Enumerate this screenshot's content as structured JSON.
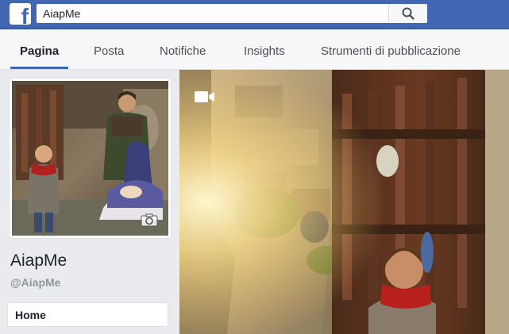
{
  "search": {
    "value": "AiapMe"
  },
  "tabs": [
    {
      "label": "Pagina",
      "active": true
    },
    {
      "label": "Posta"
    },
    {
      "label": "Notifiche"
    },
    {
      "label": "Insights"
    },
    {
      "label": "Strumenti di pubblicazione"
    }
  ],
  "page": {
    "name": "AiapMe",
    "handle": "@AiapMe"
  },
  "sidebar": {
    "items": [
      {
        "label": "Home"
      }
    ]
  },
  "icons": {
    "logo": "facebook-logo-icon",
    "search": "search-icon",
    "camera": "camera-icon",
    "video": "video-camera-icon"
  },
  "colors": {
    "brand": "#4267b2",
    "background": "#e9ebee",
    "tab_underline": "#4267b2"
  }
}
